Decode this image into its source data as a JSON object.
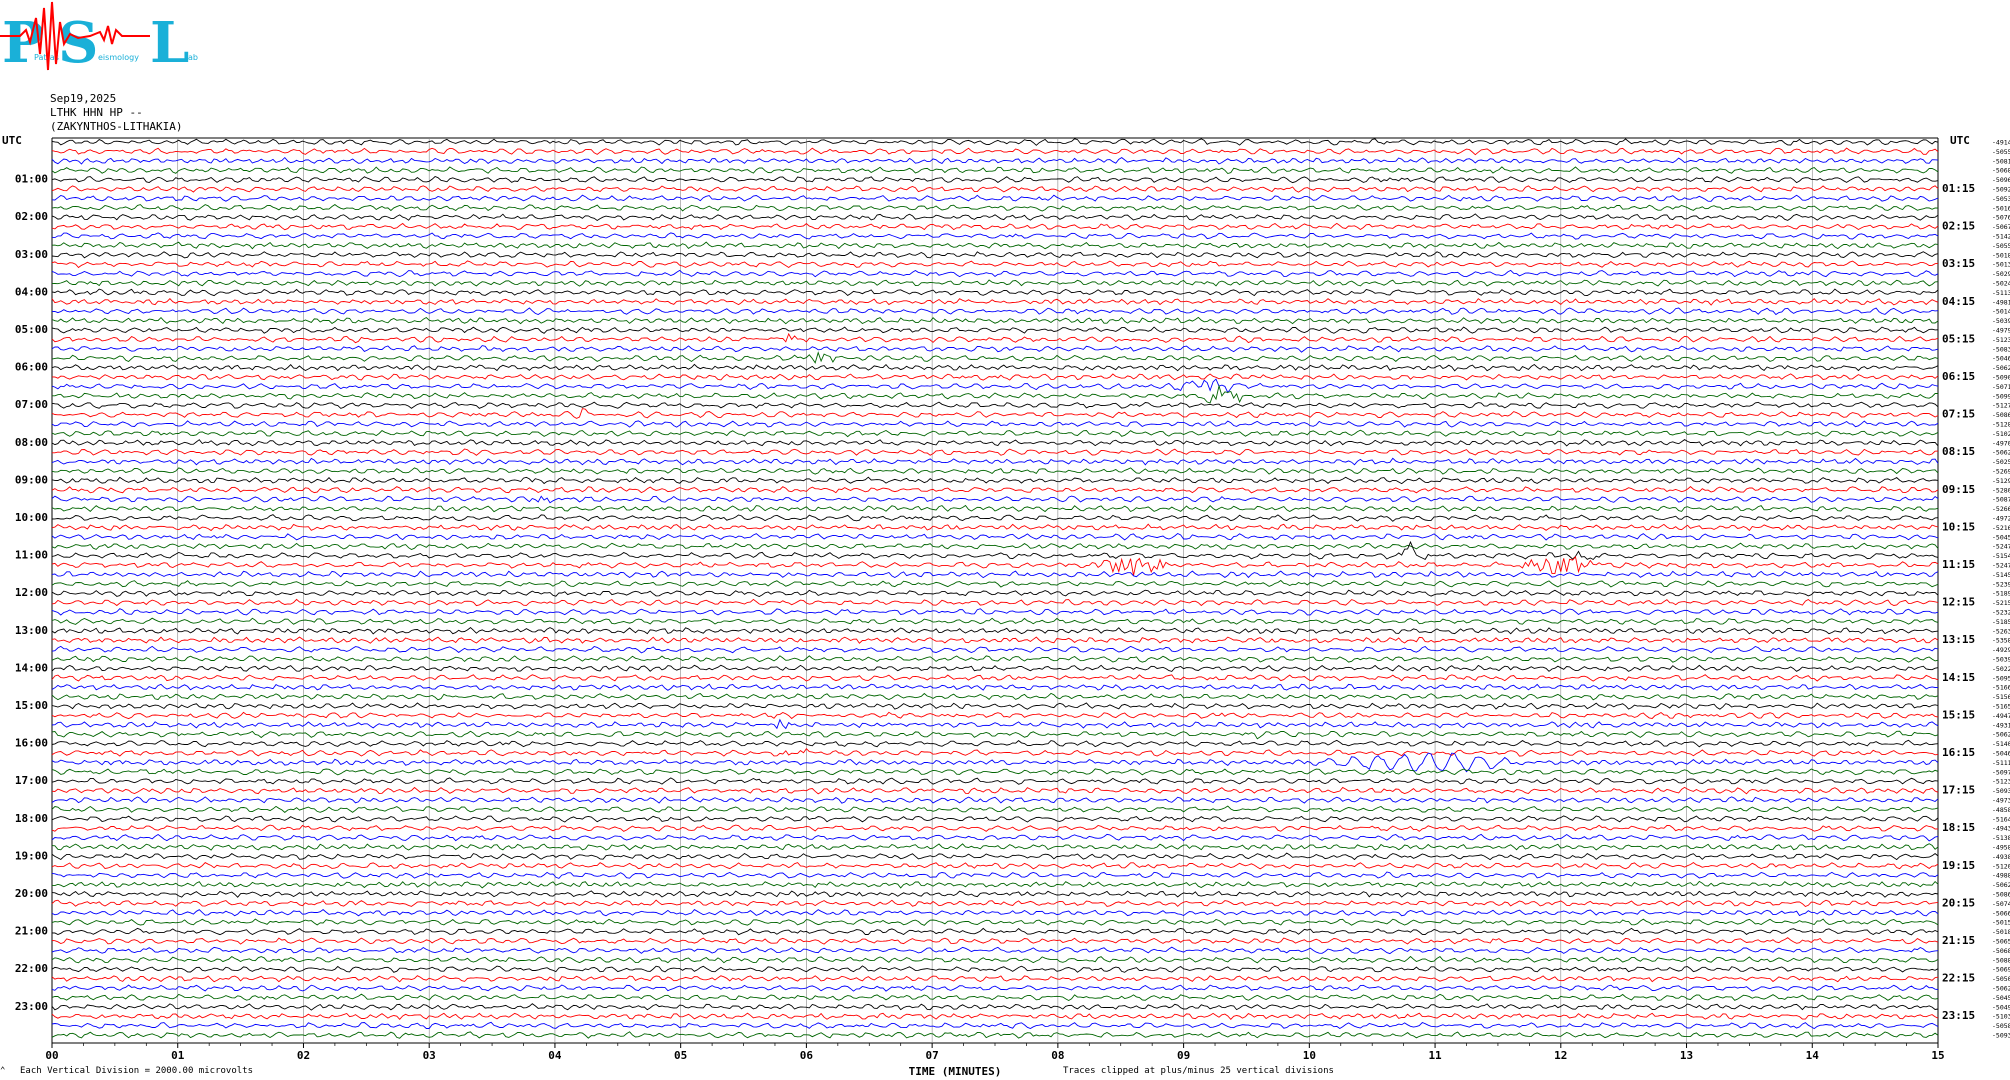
{
  "logo": {
    "letters": [
      "P",
      "S",
      "L"
    ],
    "small_text": [
      "Patras",
      "eismology",
      "ab"
    ],
    "colors": {
      "letters": "#1ab0d8",
      "trace": "#ff0000"
    }
  },
  "header": {
    "date": "Sep19,2025",
    "station": "LTHK HHN HP --",
    "location": "(ZAKYNTHOS-LITHAKIA)"
  },
  "footer": {
    "scale_note": "Each Vertical Division = 2000.00 microvolts",
    "xlabel": "TIME (MINUTES)",
    "clip_note": "Traces clipped at plus/minus 25 vertical divisions",
    "corner_mark": "⌃"
  },
  "chart_data": {
    "type": "line",
    "title": "",
    "xlabel": "TIME (MINUTES)",
    "xlim": [
      0,
      15
    ],
    "x_ticks": [
      "00",
      "01",
      "02",
      "03",
      "04",
      "05",
      "06",
      "07",
      "08",
      "09",
      "10",
      "11",
      "12",
      "13",
      "14",
      "15"
    ],
    "left_axis_label": "UTC",
    "right_axis_label": "UTC",
    "left_ticks": [
      "01:00",
      "02:00",
      "03:00",
      "04:00",
      "05:00",
      "06:00",
      "07:00",
      "08:00",
      "09:00",
      "10:00",
      "11:00",
      "12:00",
      "13:00",
      "14:00",
      "15:00",
      "16:00",
      "17:00",
      "18:00",
      "19:00",
      "20:00",
      "21:00",
      "22:00",
      "23:00"
    ],
    "right_ticks": [
      "01:15",
      "02:15",
      "03:15",
      "04:15",
      "05:15",
      "06:15",
      "07:15",
      "08:15",
      "09:15",
      "10:15",
      "11:15",
      "12:15",
      "13:15",
      "14:15",
      "15:15",
      "16:15",
      "17:15",
      "18:15",
      "19:15",
      "20:15",
      "21:15",
      "22:15",
      "23:15"
    ],
    "trace_colors": [
      "#000000",
      "#ff0000",
      "#0000ff",
      "#006400"
    ],
    "trace_count": 96,
    "trace_minutes_each": 15,
    "right_offsets": [
      "-4914",
      "-5055",
      "-5081",
      "-5068",
      "-5096",
      "-5092",
      "-5053",
      "-5016",
      "-5076",
      "-5067",
      "-5142",
      "-5055",
      "-5018",
      "-5013",
      "-5029",
      "-5024",
      "-5113",
      "-4981",
      "-5014",
      "-5039",
      "-4979",
      "-5123",
      "-5083",
      "-5046",
      "-5062",
      "-5090",
      "-5071",
      "-5099",
      "-5127",
      "-5086",
      "-5128",
      "-5102",
      "-4970",
      "-5062",
      "-5025",
      "-5269",
      "-5129",
      "-5280",
      "-5087",
      "-5266",
      "-4972",
      "-5216",
      "-5045",
      "-5247",
      "-5154",
      "-5247",
      "-5145",
      "-5239",
      "-5189",
      "-5215",
      "-5232",
      "-5185",
      "-5263",
      "-5358",
      "-4929",
      "-5039",
      "-5022",
      "-5095",
      "-5166",
      "-5156",
      "-5165",
      "-4947",
      "-4931",
      "-5062",
      "-5140",
      "-5046",
      "-5111",
      "-5097",
      "-5123",
      "-5093",
      "-4973",
      "-4858",
      "-5164",
      "-4943",
      "-5138",
      "-4958",
      "-4938",
      "-5120",
      "-4988",
      "-5062",
      "-5086",
      "-5074",
      "-5066",
      "-5015",
      "-5018",
      "-5065",
      "-5068",
      "-5088",
      "-5069",
      "-5050",
      "-5062",
      "-5045",
      "-5049",
      "-5103",
      "-5058",
      "-5093"
    ],
    "events": [
      {
        "trace": 21,
        "minute": 5.9,
        "amplitude": 1.6,
        "width": 0.25
      },
      {
        "trace": 23,
        "minute": 6.1,
        "amplitude": 1.4,
        "width": 0.25
      },
      {
        "trace": 26,
        "minute": 9.2,
        "amplitude": 2.2,
        "width": 0.45
      },
      {
        "trace": 27,
        "minute": 9.3,
        "amplitude": 2.4,
        "width": 0.35
      },
      {
        "trace": 29,
        "minute": 4.2,
        "amplitude": 1.8,
        "width": 0.15
      },
      {
        "trace": 38,
        "minute": 3.9,
        "amplitude": 1.6,
        "width": 0.15
      },
      {
        "trace": 44,
        "minute": 10.8,
        "amplitude": 3.6,
        "width": 0.2
      },
      {
        "trace": 44,
        "minute": 12.1,
        "amplitude": 2.6,
        "width": 0.3
      },
      {
        "trace": 45,
        "minute": 8.6,
        "amplitude": 2.8,
        "width": 0.45
      },
      {
        "trace": 45,
        "minute": 12.0,
        "amplitude": 2.4,
        "width": 0.5
      },
      {
        "trace": 61,
        "minute": 9.3,
        "amplitude": 1.3,
        "width": 0.1
      },
      {
        "trace": 62,
        "minute": 5.8,
        "amplitude": 1.2,
        "width": 0.2
      },
      {
        "trace": 63,
        "minute": 9.6,
        "amplitude": 1.1,
        "width": 0.3
      },
      {
        "trace": 65,
        "minute": 5.9,
        "amplitude": 1.2,
        "width": 0.3
      }
    ],
    "long_period_wave": {
      "trace": 66,
      "start_minute": 10.0,
      "end_minute": 11.8,
      "amplitude": 2.2,
      "period_minutes": 0.2
    }
  }
}
